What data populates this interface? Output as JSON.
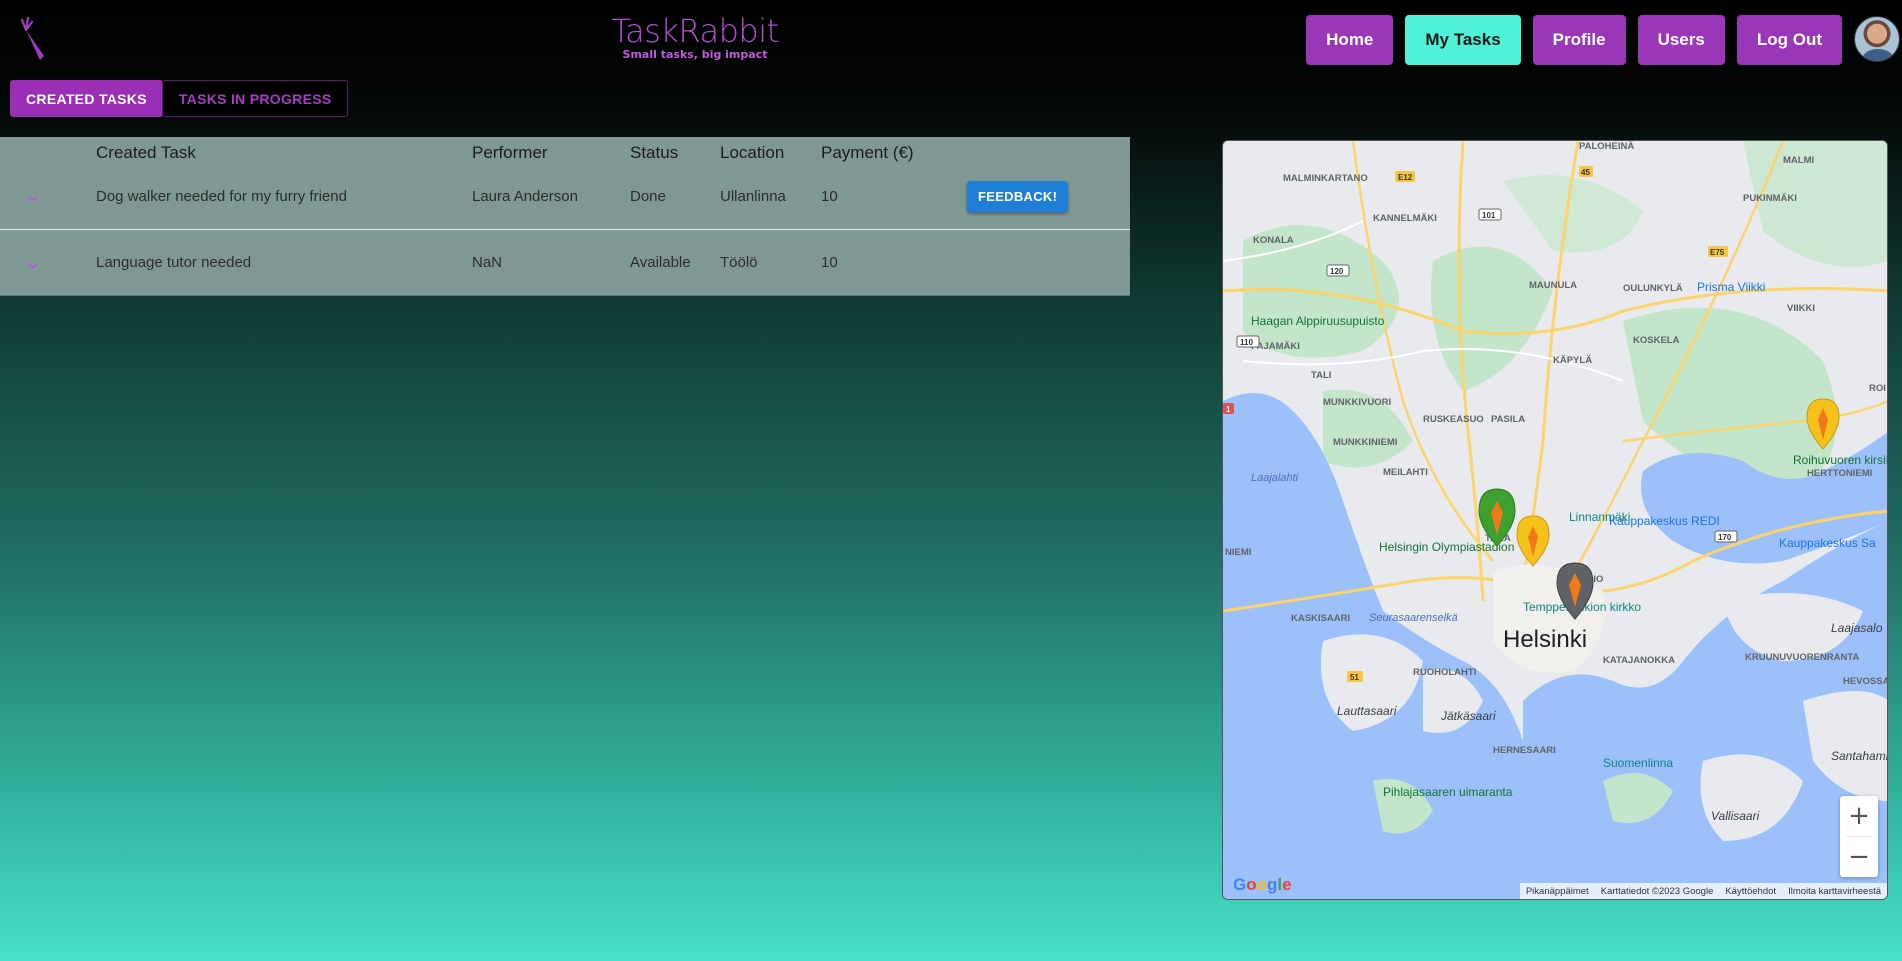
{
  "header": {
    "brand_title": "TaskRabbit",
    "brand_tagline": "Small tasks, big impact"
  },
  "nav": {
    "home": "Home",
    "my_tasks": "My Tasks",
    "profile": "Profile",
    "users": "Users",
    "logout": "Log Out"
  },
  "tabs": {
    "created": "CREATED TASKS",
    "in_progress": "TASKS IN PROGRESS"
  },
  "table": {
    "headers": [
      "Created Task",
      "Performer",
      "Status",
      "Location",
      "Payment (€)"
    ],
    "rows": [
      {
        "task": "Dog walker needed for my furry friend",
        "performer": "Laura Anderson",
        "status": "Done",
        "location": "Ullanlinna",
        "payment": "10",
        "action": "FEEDBACK!"
      },
      {
        "task": "Language tutor needed",
        "performer": "NaN",
        "status": "Available",
        "location": "Töölö",
        "payment": "10"
      }
    ]
  },
  "map": {
    "places": {
      "paloheina": "PALOHEINÄ",
      "malmi": "MALMI",
      "malminkartano": "MALMINKARTANO",
      "kannelmaki": "KANNELMÄKI",
      "pukinmaki": "PUKINMÄKI",
      "konala": "KONALA",
      "maunula": "MAUNULA",
      "oulunkyla": "OULUNKYLÄ",
      "prisma": "Prisma Viikki",
      "viikki": "VIIKKI",
      "haagan": "Haagan Alppiruusupuisto",
      "pajamaki": "PAJAMÄKI",
      "koskela": "KOSKELA",
      "kapyla": "KÄPYLÄ",
      "tali": "TALI",
      "munkkivuori": "MUNKKIVUORI",
      "ruskeasuo": "RUSKEASUO",
      "pasila": "PASILA",
      "laajalahti": "Laajalahti",
      "munkkiniemi": "MUNKKINIEMI",
      "roihu": "Roihuvuoren kirsikkapuisto",
      "herttoniemi": "HERTTONIEMI",
      "meilahti": "MEILAHTI",
      "linnanmaki": "Linnanmäki",
      "redi": "Kauppakeskus REDI",
      "kauppakeskus_sa": "Kauppakeskus Sa",
      "olympia": "Helsingin Olympiastadion",
      "taka": "TAKA",
      "kallio": "KALLIO",
      "kirkko": "Temppeliaukion kirkko",
      "kaskisaari": "KASKISAARI",
      "seurasaari": "Seurasaarenselkä",
      "helsinki": "Helsinki",
      "laajasalo": "Laajasalo",
      "ruoholahti": "RUOHOLAHTI",
      "katajanokka": "KATAJANOKKA",
      "kruunuvuorenranta": "KRUUNUVUORENRANTA",
      "hevossa": "HEVOSSA",
      "lauttasaari": "Lauttasaari",
      "jatkasaari": "Jätkäsaari",
      "hernesaari": "HERNESAARI",
      "suomenlinna": "Suomenlinna",
      "santahamina": "Santahamina",
      "pihlajasaari": "Pihlajasaaren uimaranta",
      "vallisaari": "Vallisaari",
      "roihu_short": "ROI",
      "niemi": "NIEMI"
    },
    "roads": [
      "E12",
      "45",
      "101",
      "120",
      "110",
      "E75",
      "170",
      "51",
      "1"
    ],
    "zoom_in": "+",
    "zoom_out": "−",
    "footer": [
      "Pikanäppäimet",
      "Karttatiedot ©2023 Google",
      "Käyttöehdot",
      "Ilmoita karttavirheestä"
    ],
    "google": "Google",
    "colors": {
      "land": "#e8eaed",
      "water": "#9cc0f9",
      "park": "#c3e6cb",
      "road": "#fbd46b",
      "marker_green": "#3ea02f",
      "marker_yellow": "#f5c21b",
      "marker_gray": "#5f6368"
    }
  },
  "colors": {
    "accent": "#9a36b8",
    "active_nav": "#4ff2d6",
    "feedback_button": "#1e7ed8",
    "table_bg": "#7f9894"
  }
}
